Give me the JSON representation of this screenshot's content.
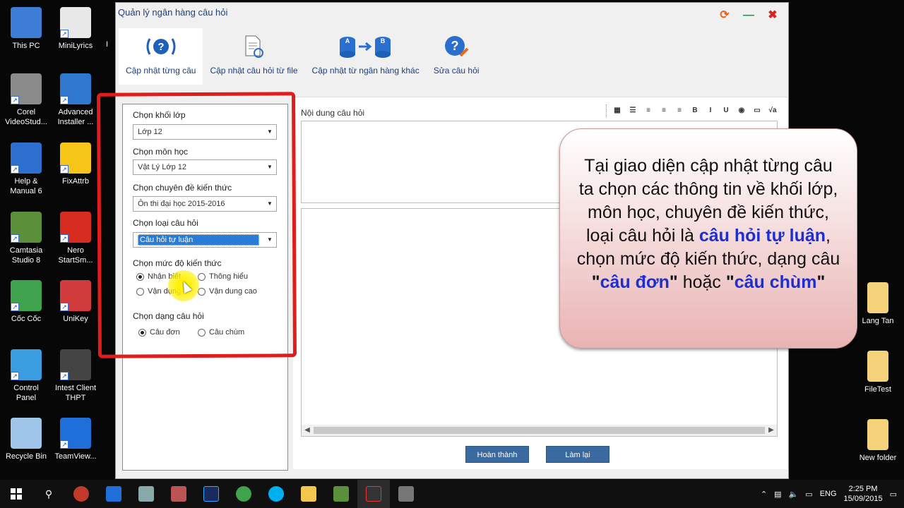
{
  "desktop": {
    "left_icons": [
      {
        "label": "This PC",
        "color": "#3d7dd6"
      },
      {
        "label": "MiniLyrics",
        "color": "#e8e8e8"
      },
      {
        "label": "Corel\nVideoStud...",
        "color": "#8a8a8a"
      },
      {
        "label": "Advanced\nInstaller ...",
        "color": "#2f78d0"
      },
      {
        "label": "Help &\nManual 6",
        "color": "#2d6fcf"
      },
      {
        "label": "FixAttrb",
        "color": "#f5c518"
      },
      {
        "label": "Camtasia\nStudio 8",
        "color": "#5b8f3a"
      },
      {
        "label": "Nero\nStartSm...",
        "color": "#d62d20"
      },
      {
        "label": "Cốc Cốc",
        "color": "#3fa34d"
      },
      {
        "label": "UniKey",
        "color": "#d23b3b"
      },
      {
        "label": "Control\nPanel",
        "color": "#3a9de0"
      },
      {
        "label": "Intest Client\nTHPT",
        "color": "#444444"
      },
      {
        "label": "Recycle Bin",
        "color": "#9fc5e8"
      },
      {
        "label": "TeamView...",
        "color": "#1e6fd9"
      }
    ],
    "right_icons": [
      {
        "label": "Lang Tan"
      },
      {
        "label": "FileTest"
      },
      {
        "label": "New folder"
      }
    ],
    "partial_label": "I"
  },
  "window": {
    "title": "Quản lý ngân hàng câu hỏi",
    "controls": {
      "refresh": "⟳",
      "minimize": "—",
      "close": "✖"
    },
    "tabs": [
      {
        "label": "Cập nhật từng câu",
        "icon": "question-circle-icon",
        "active": true
      },
      {
        "label": "Cập nhật câu hỏi từ file",
        "icon": "file-refresh-icon",
        "active": false
      },
      {
        "label": "Cập nhật từ ngân hàng khác",
        "icon": "database-transfer-icon",
        "active": false
      },
      {
        "label": "Sửa câu hỏi",
        "icon": "question-edit-icon",
        "active": false
      }
    ]
  },
  "form": {
    "grade_label": "Chọn khối lớp",
    "grade_value": "Lớp 12",
    "subject_label": "Chọn môn học",
    "subject_value": "Vật Lý Lớp 12",
    "topic_label": "Chọn chuyên đề kiến thức",
    "topic_value": "Ôn thi đại học 2015-2016",
    "type_label": "Chọn loại câu hỏi",
    "type_value": "Câu hỏi tự luận",
    "level_label": "Chọn mức độ kiến thức",
    "levels": [
      {
        "label": "Nhận biết",
        "checked": true
      },
      {
        "label": "Thông hiểu",
        "checked": false
      },
      {
        "label": "Vận dụng",
        "checked": false
      },
      {
        "label": "Vận dung cao",
        "checked": false
      }
    ],
    "form_type_label": "Chọn dạng câu hỏi",
    "form_types": [
      {
        "label": "Câu đơn",
        "checked": true
      },
      {
        "label": "Câu chùm",
        "checked": false
      }
    ]
  },
  "editor": {
    "label": "Nội dung câu hỏi",
    "tools": [
      "▦",
      "☰",
      "≡",
      "≡",
      "≡",
      "B",
      "I",
      "U",
      "◉",
      "▭",
      "√a"
    ],
    "finish_button": "Hoàn thành",
    "reset_button": "Làm lại"
  },
  "callout": {
    "text_1": "Tại giao diện cập nhật từng câu ta chọn các thông tin về khối lớp, môn học, chuyên đề kiến thức, loại câu hỏi là ",
    "highlight_1": "câu hỏi tự luận",
    "text_2": ", chọn mức độ kiến thức, dạng câu ",
    "quote_open_1": "\"",
    "highlight_2": "câu đơn",
    "quote_close_1": "\"",
    "text_3": " hoặc ",
    "quote_open_2": "\"",
    "highlight_3": "câu chùm",
    "quote_close_2": "\""
  },
  "taskbar": {
    "language": "ENG",
    "time": "2:25 PM",
    "date": "15/09/2015",
    "start_icon": "windows-icon",
    "search_icon": "search-icon"
  },
  "colors": {
    "accent": "#1d2fd0",
    "annotation": "#e01c1c",
    "button": "#3a6aa0"
  }
}
